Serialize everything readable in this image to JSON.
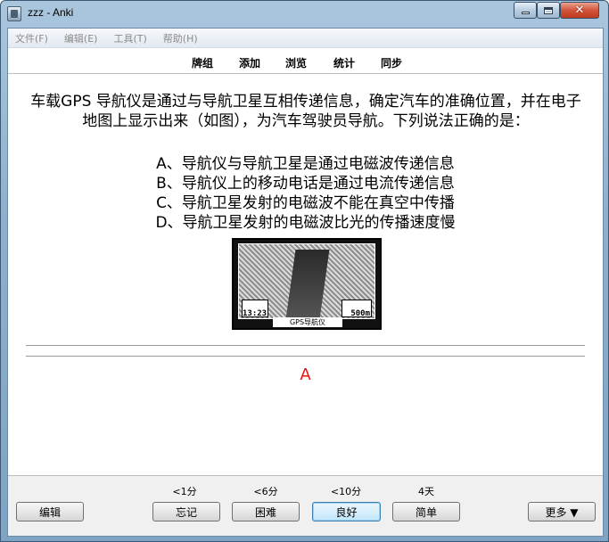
{
  "window": {
    "title": "zzz - Anki",
    "minimize_label": "",
    "maximize_label": "",
    "close_label": "✕"
  },
  "menu": {
    "items": [
      "文件(F)",
      "编辑(E)",
      "工具(T)",
      "帮助(H)"
    ]
  },
  "toolbar": {
    "links": [
      "牌组",
      "添加",
      "浏览",
      "统计",
      "同步"
    ]
  },
  "card": {
    "question": "车载GPS 导航仪是通过与导航卫星互相传递信息，确定汽车的准确位置，并在电子地图上显示出来（如图），为汽车驾驶员导航。下列说法正确的是：",
    "options": [
      "A、导航仪与导航卫星是通过电磁波传递信息",
      "B、导航仪上的移动电话是通过电流传递信息",
      "C、导航卫星发射的电磁波不能在真空中传播",
      "D、导航卫星发射的电磁波比光的传播速度慢"
    ],
    "figure": {
      "caption": "GPS导航仪",
      "time": "13:23",
      "distance": "500m"
    },
    "answer": "A",
    "answer_color": "#ee1111"
  },
  "review": {
    "edit_label": "编辑",
    "more_label": "更多 ▼",
    "answers": [
      {
        "interval": "<1分",
        "label": "忘记"
      },
      {
        "interval": "<6分",
        "label": "困难"
      },
      {
        "interval": "<10分",
        "label": "良好"
      },
      {
        "interval": "4天",
        "label": "简单"
      }
    ]
  }
}
